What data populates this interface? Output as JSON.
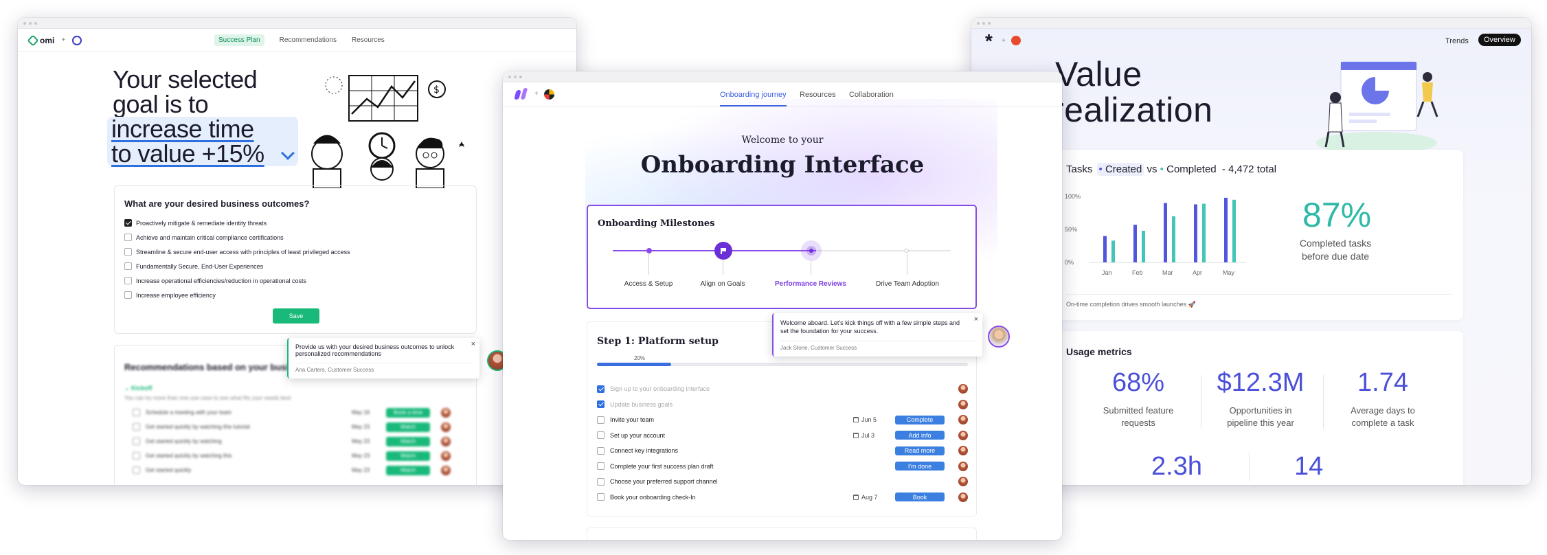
{
  "left": {
    "nav": {
      "brand": "omi",
      "tabs": [
        "Success Plan",
        "Recommendations",
        "Resources"
      ]
    },
    "hero": {
      "line1": "Your selected",
      "line2": "goal is to",
      "highlight1": "increase time",
      "highlight2": "to value +15%"
    },
    "outcomes": {
      "title": "What are your desired business outcomes?",
      "items": [
        {
          "label": "Proactively mitigate & remediate identity threats",
          "checked": true
        },
        {
          "label": "Achieve and maintain critical compliance certifications",
          "checked": false
        },
        {
          "label": "Streamline & secure end-user access with principles of least privileged access",
          "checked": false
        },
        {
          "label": "Fundamentally Secure, End-User Experiences",
          "checked": false
        },
        {
          "label": "Increase operational efficiencies/reduction in operational costs",
          "checked": false
        },
        {
          "label": "Increase employee efficiency",
          "checked": false
        }
      ],
      "save": "Save"
    },
    "recs": {
      "title": "Recommendations based on your busin",
      "section": "Kickoff",
      "sub": "You can try more than one use case to see what fits your needs best",
      "rows": [
        {
          "label": "Schedule a meeting with your team",
          "date": "May 16",
          "action": "Book a time"
        },
        {
          "label": "Get started quickly by watching this tutorial",
          "date": "May 23",
          "action": "Watch"
        },
        {
          "label": "Get started quickly by watching",
          "date": "May 23",
          "action": "Watch"
        },
        {
          "label": "Get started quickly by watching this",
          "date": "May 23",
          "action": "Watch"
        },
        {
          "label": "Get started quickly",
          "date": "May 23",
          "action": "Watch"
        }
      ]
    },
    "tooltip": {
      "text": "Provide us with your desired business outcomes to unlock personalized recommendations",
      "sig": "Ana Carters, Customer Success",
      "close": "×"
    }
  },
  "center": {
    "nav": {
      "tabs": [
        "Onboarding journey",
        "Resources",
        "Collaboration"
      ]
    },
    "welcome": "Welcome to your",
    "title": "Onboarding Interface",
    "milestones": {
      "title": "Onboarding Milestones",
      "steps": [
        "Access & Setup",
        "Align on Goals",
        "Performance Reviews",
        "Drive Team Adoption"
      ]
    },
    "step": {
      "title": "Step 1: Platform setup",
      "progress_label": "20%",
      "progress": 0.2,
      "tasks": [
        {
          "label": "Sign up to your onboarding interface",
          "done": true,
          "date": "",
          "action": ""
        },
        {
          "label": "Update business goals",
          "done": true,
          "date": "",
          "action": ""
        },
        {
          "label": "Invite your team",
          "done": false,
          "date": "Jun 5",
          "action": "Complete"
        },
        {
          "label": "Set up your account",
          "done": false,
          "date": "Jul 3",
          "action": "Add info"
        },
        {
          "label": "Connect key integrations",
          "done": false,
          "date": "",
          "action": "Read more"
        },
        {
          "label": "Complete your first success plan draft",
          "done": false,
          "date": "",
          "action": "I'm done"
        },
        {
          "label": "Choose your preferred support channel",
          "done": false,
          "date": "",
          "action": ""
        },
        {
          "label": "Book your onboarding check-In",
          "done": false,
          "date": "Aug 7",
          "action": "Book"
        }
      ]
    },
    "tooltip": {
      "text": "Welcome aboard. Let's kick things off with a few simple steps and set the foundation for your success.",
      "sig": "Jack Stone, Customer Success",
      "close": "×"
    }
  },
  "right": {
    "nav": {
      "tabs": [
        "Trends",
        "Overview"
      ]
    },
    "hero": {
      "line1": "Value",
      "line2": "realization"
    },
    "tasks_card": {
      "title_prefix": "Tasks",
      "created": "Created",
      "vs": "vs",
      "completed": "Completed",
      "total": "- 4,472 total",
      "kpi": "87%",
      "kpi_label_1": "Completed tasks",
      "kpi_label_2": "before due date",
      "footer": "On-time completion drives smooth launches 🚀"
    },
    "chart_data": {
      "type": "bar",
      "categories": [
        "Jan",
        "Feb",
        "Mar",
        "Apr",
        "May"
      ],
      "yticks": [
        "100%",
        "50%",
        "0%"
      ],
      "ylim": [
        0,
        100
      ],
      "series": [
        {
          "name": "Created",
          "color": "#5156dc",
          "values": [
            40,
            57,
            90,
            88,
            98
          ]
        },
        {
          "name": "Completed",
          "color": "#45c4b8",
          "values": [
            33,
            48,
            70,
            89,
            95
          ]
        }
      ]
    },
    "usage": {
      "title": "Usage metrics",
      "metrics": [
        {
          "value": "68%",
          "label1": "Submitted feature",
          "label2": "requests"
        },
        {
          "value": "$12.3M",
          "label1": "Opportunities in",
          "label2": "pipeline this year"
        },
        {
          "value": "1.74",
          "label1": "Average days to",
          "label2": "complete a task"
        }
      ],
      "bottom": [
        "2.3h",
        "14"
      ]
    }
  }
}
